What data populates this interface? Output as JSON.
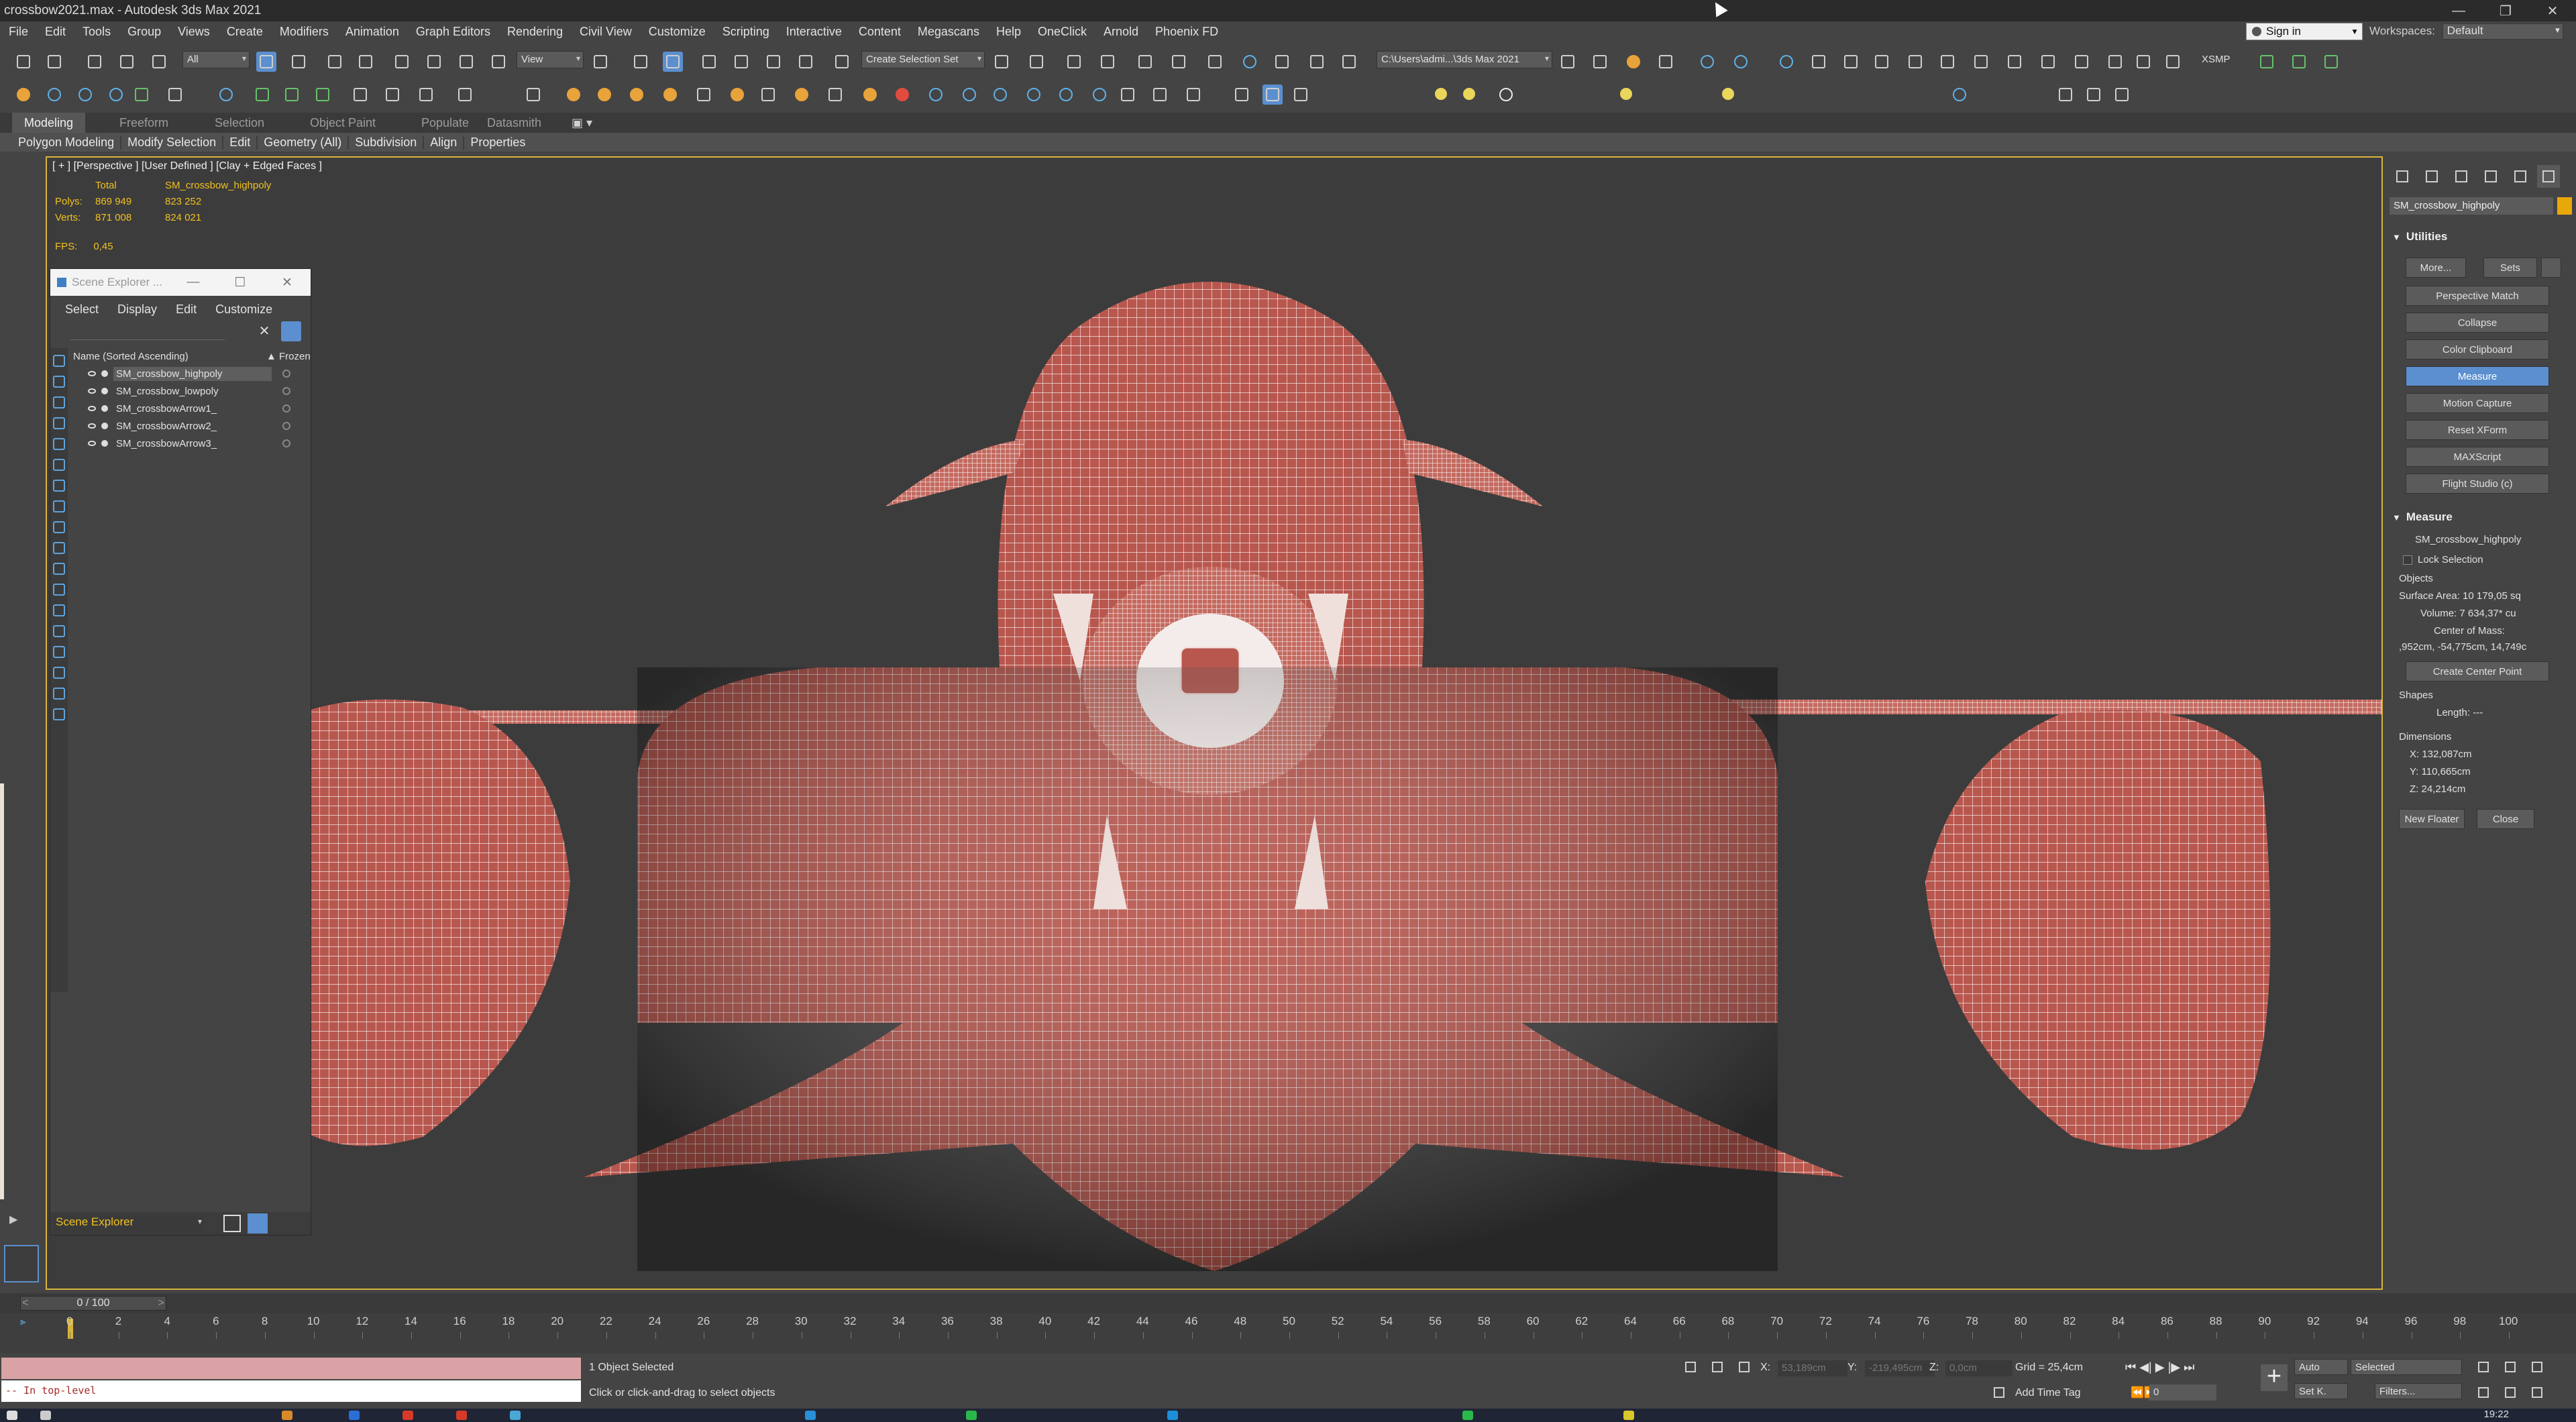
{
  "title_bar": {
    "title": "crossbow2021.max - Autodesk 3ds Max 2021"
  },
  "menu": [
    "File",
    "Edit",
    "Tools",
    "Group",
    "Views",
    "Create",
    "Modifiers",
    "Animation",
    "Graph Editors",
    "Rendering",
    "Civil View",
    "Customize",
    "Scripting",
    "Interactive",
    "Content",
    "Megascans",
    "Help",
    "OneClick",
    "Arnold",
    "Phoenix FD"
  ],
  "account": {
    "sign_in": "Sign in",
    "workspaces_label": "Workspaces:",
    "workspace": "Default"
  },
  "main_toolbar": {
    "selection_filter": "All",
    "ref_coord": "View",
    "named_selection": "Create Selection Set",
    "project_path": "C:\\Users\\admi...\\3ds Max 2021",
    "xsmp_label": "XSMP"
  },
  "ribbon": {
    "tabs": [
      "Modeling",
      "Freeform",
      "Selection",
      "Object Paint",
      "Populate",
      "Datasmith"
    ],
    "active_tab": "Modeling",
    "panels": [
      "Polygon Modeling",
      "Modify Selection",
      "Edit",
      "Geometry (All)",
      "Subdivision",
      "Align",
      "Properties"
    ]
  },
  "viewport": {
    "label": "[ + ] [Perspective ] [User Defined ] [Clay + Edged Faces ]",
    "stats": {
      "header_total": "Total",
      "header_object": "SM_crossbow_highpoly",
      "polys_label": "Polys:",
      "polys_total": "869 949",
      "polys_obj": "823 252",
      "verts_label": "Verts:",
      "verts_total": "871 008",
      "verts_obj": "824 021"
    },
    "fps_label": "FPS:",
    "fps_value": "0,45",
    "model_colors": {
      "surface": "#b8574e",
      "wire": "#f3e3e0"
    }
  },
  "scene_explorer": {
    "title": "Scene Explorer ...",
    "menu": [
      "Select",
      "Display",
      "Edit",
      "Customize"
    ],
    "column_name": "Name (Sorted Ascending)",
    "column_frozen": "▲ Frozen",
    "items": [
      {
        "name": "SM_crossbow_highpoly",
        "selected": true
      },
      {
        "name": "SM_crossbow_lowpoly",
        "selected": false
      },
      {
        "name": "SM_crossbowArrow1_",
        "selected": false
      },
      {
        "name": "SM_crossbowArrow2_",
        "selected": false
      },
      {
        "name": "SM_crossbowArrow3_",
        "selected": false
      }
    ],
    "footer_label": "Scene Explorer"
  },
  "command_panel": {
    "object_name": "SM_crossbow_highpoly",
    "object_color": "#e8a80a",
    "utilities_title": "Utilities",
    "more": "More...",
    "sets": "Sets",
    "utilities": [
      "Perspective Match",
      "Collapse",
      "Color Clipboard",
      "Measure",
      "Motion Capture",
      "Reset XForm",
      "MAXScript",
      "Flight Studio (c)"
    ],
    "active_utility": "Measure",
    "measure_title": "Measure",
    "measure_object": "SM_crossbow_highpoly",
    "lock_selection": "Lock Selection",
    "objects_label": "Objects",
    "surface_area": "Surface Area: 10 179,05 sq",
    "volume": "Volume: 7 634,37* cu",
    "center_of_mass_label": "Center of Mass:",
    "center_of_mass": ",952cm, -54,775cm, 14,749c",
    "create_center_point": "Create Center Point",
    "shapes_label": "Shapes",
    "length": "Length: ---",
    "dimensions_label": "Dimensions",
    "dim_x": "X:  132,087cm",
    "dim_y": "Y:  110,665cm",
    "dim_z": "Z:  24,214cm",
    "new_floater": "New Floater",
    "close": "Close"
  },
  "time_slider": {
    "position": "0 / 100",
    "prev": "<",
    "next": ">"
  },
  "track_ticks": [
    "0",
    "2",
    "4",
    "6",
    "8",
    "10",
    "12",
    "14",
    "16",
    "18",
    "20",
    "22",
    "24",
    "26",
    "28",
    "30",
    "32",
    "34",
    "36",
    "38",
    "40",
    "42",
    "44",
    "46",
    "48",
    "50",
    "52",
    "54",
    "56",
    "58",
    "60",
    "62",
    "64",
    "66",
    "68",
    "70",
    "72",
    "74",
    "76",
    "78",
    "80",
    "82",
    "84",
    "86",
    "88",
    "90",
    "92",
    "94",
    "96",
    "98",
    "100"
  ],
  "status_bar": {
    "maxscript_text": "-- In top-level",
    "selection_status": "1 Object Selected",
    "prompt": "Click or click-and-drag to select objects",
    "x_label": "X:",
    "x_value": "53,189cm",
    "y_label": "Y:",
    "y_value": "-219,495cm",
    "z_label": "Z:",
    "z_value": "0,0cm",
    "grid": "Grid = 25,4cm",
    "add_time_tag": "Add Time Tag",
    "auto": "Auto",
    "selected": "Selected",
    "set_k": "Set K.",
    "filters": "Filters...",
    "frame": "0"
  },
  "taskbar": {
    "clock": "19:22"
  }
}
